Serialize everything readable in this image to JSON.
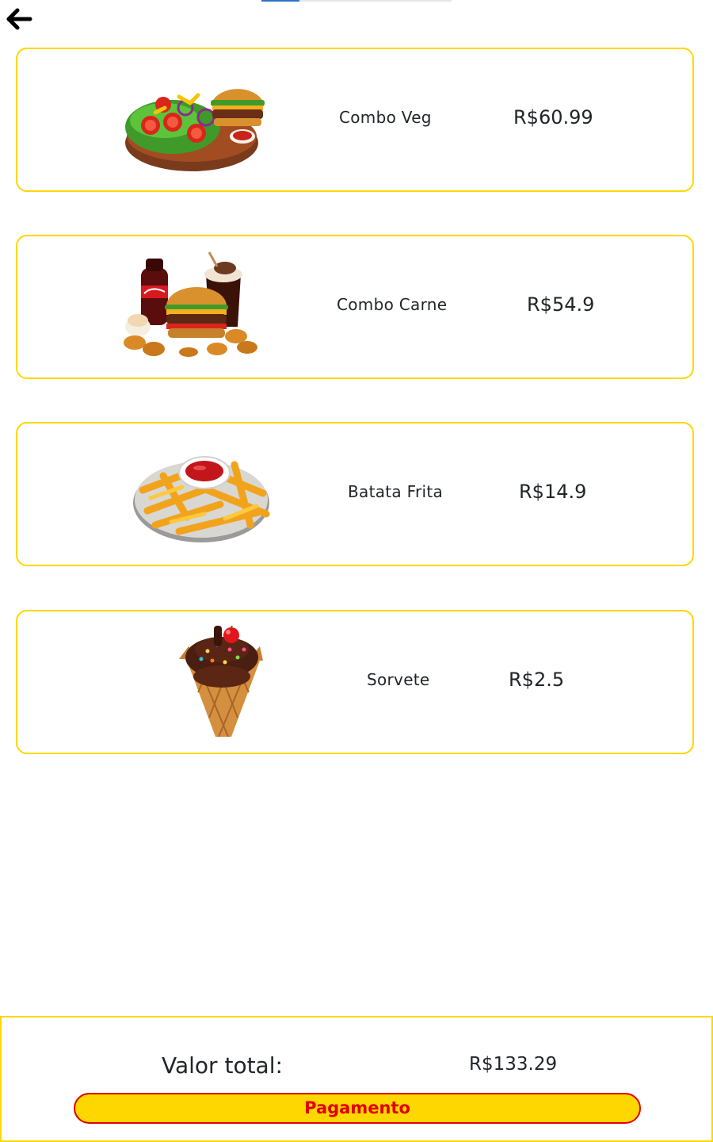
{
  "nav": {
    "back_icon": "arrow-left-icon"
  },
  "items": [
    {
      "name": "Combo Veg",
      "price": "R$60.99",
      "image_icon": "salad-burger-combo-image"
    },
    {
      "name": "Combo Carne",
      "price": "R$54.9",
      "image_icon": "burger-soda-nuggets-combo-image"
    },
    {
      "name": "Batata Frita",
      "price": "R$14.9",
      "image_icon": "french-fries-ketchup-image"
    },
    {
      "name": "Sorvete",
      "price": "R$2.5",
      "image_icon": "chocolate-ice-cream-cone-image"
    }
  ],
  "summary": {
    "total_label": "Valor total:",
    "total_value": "R$133.29",
    "pay_label": "Pagamento"
  },
  "colors": {
    "card_border": "#ffd700",
    "button_background": "#ffd700",
    "button_text": "#e00000",
    "button_border": "#e00000"
  }
}
